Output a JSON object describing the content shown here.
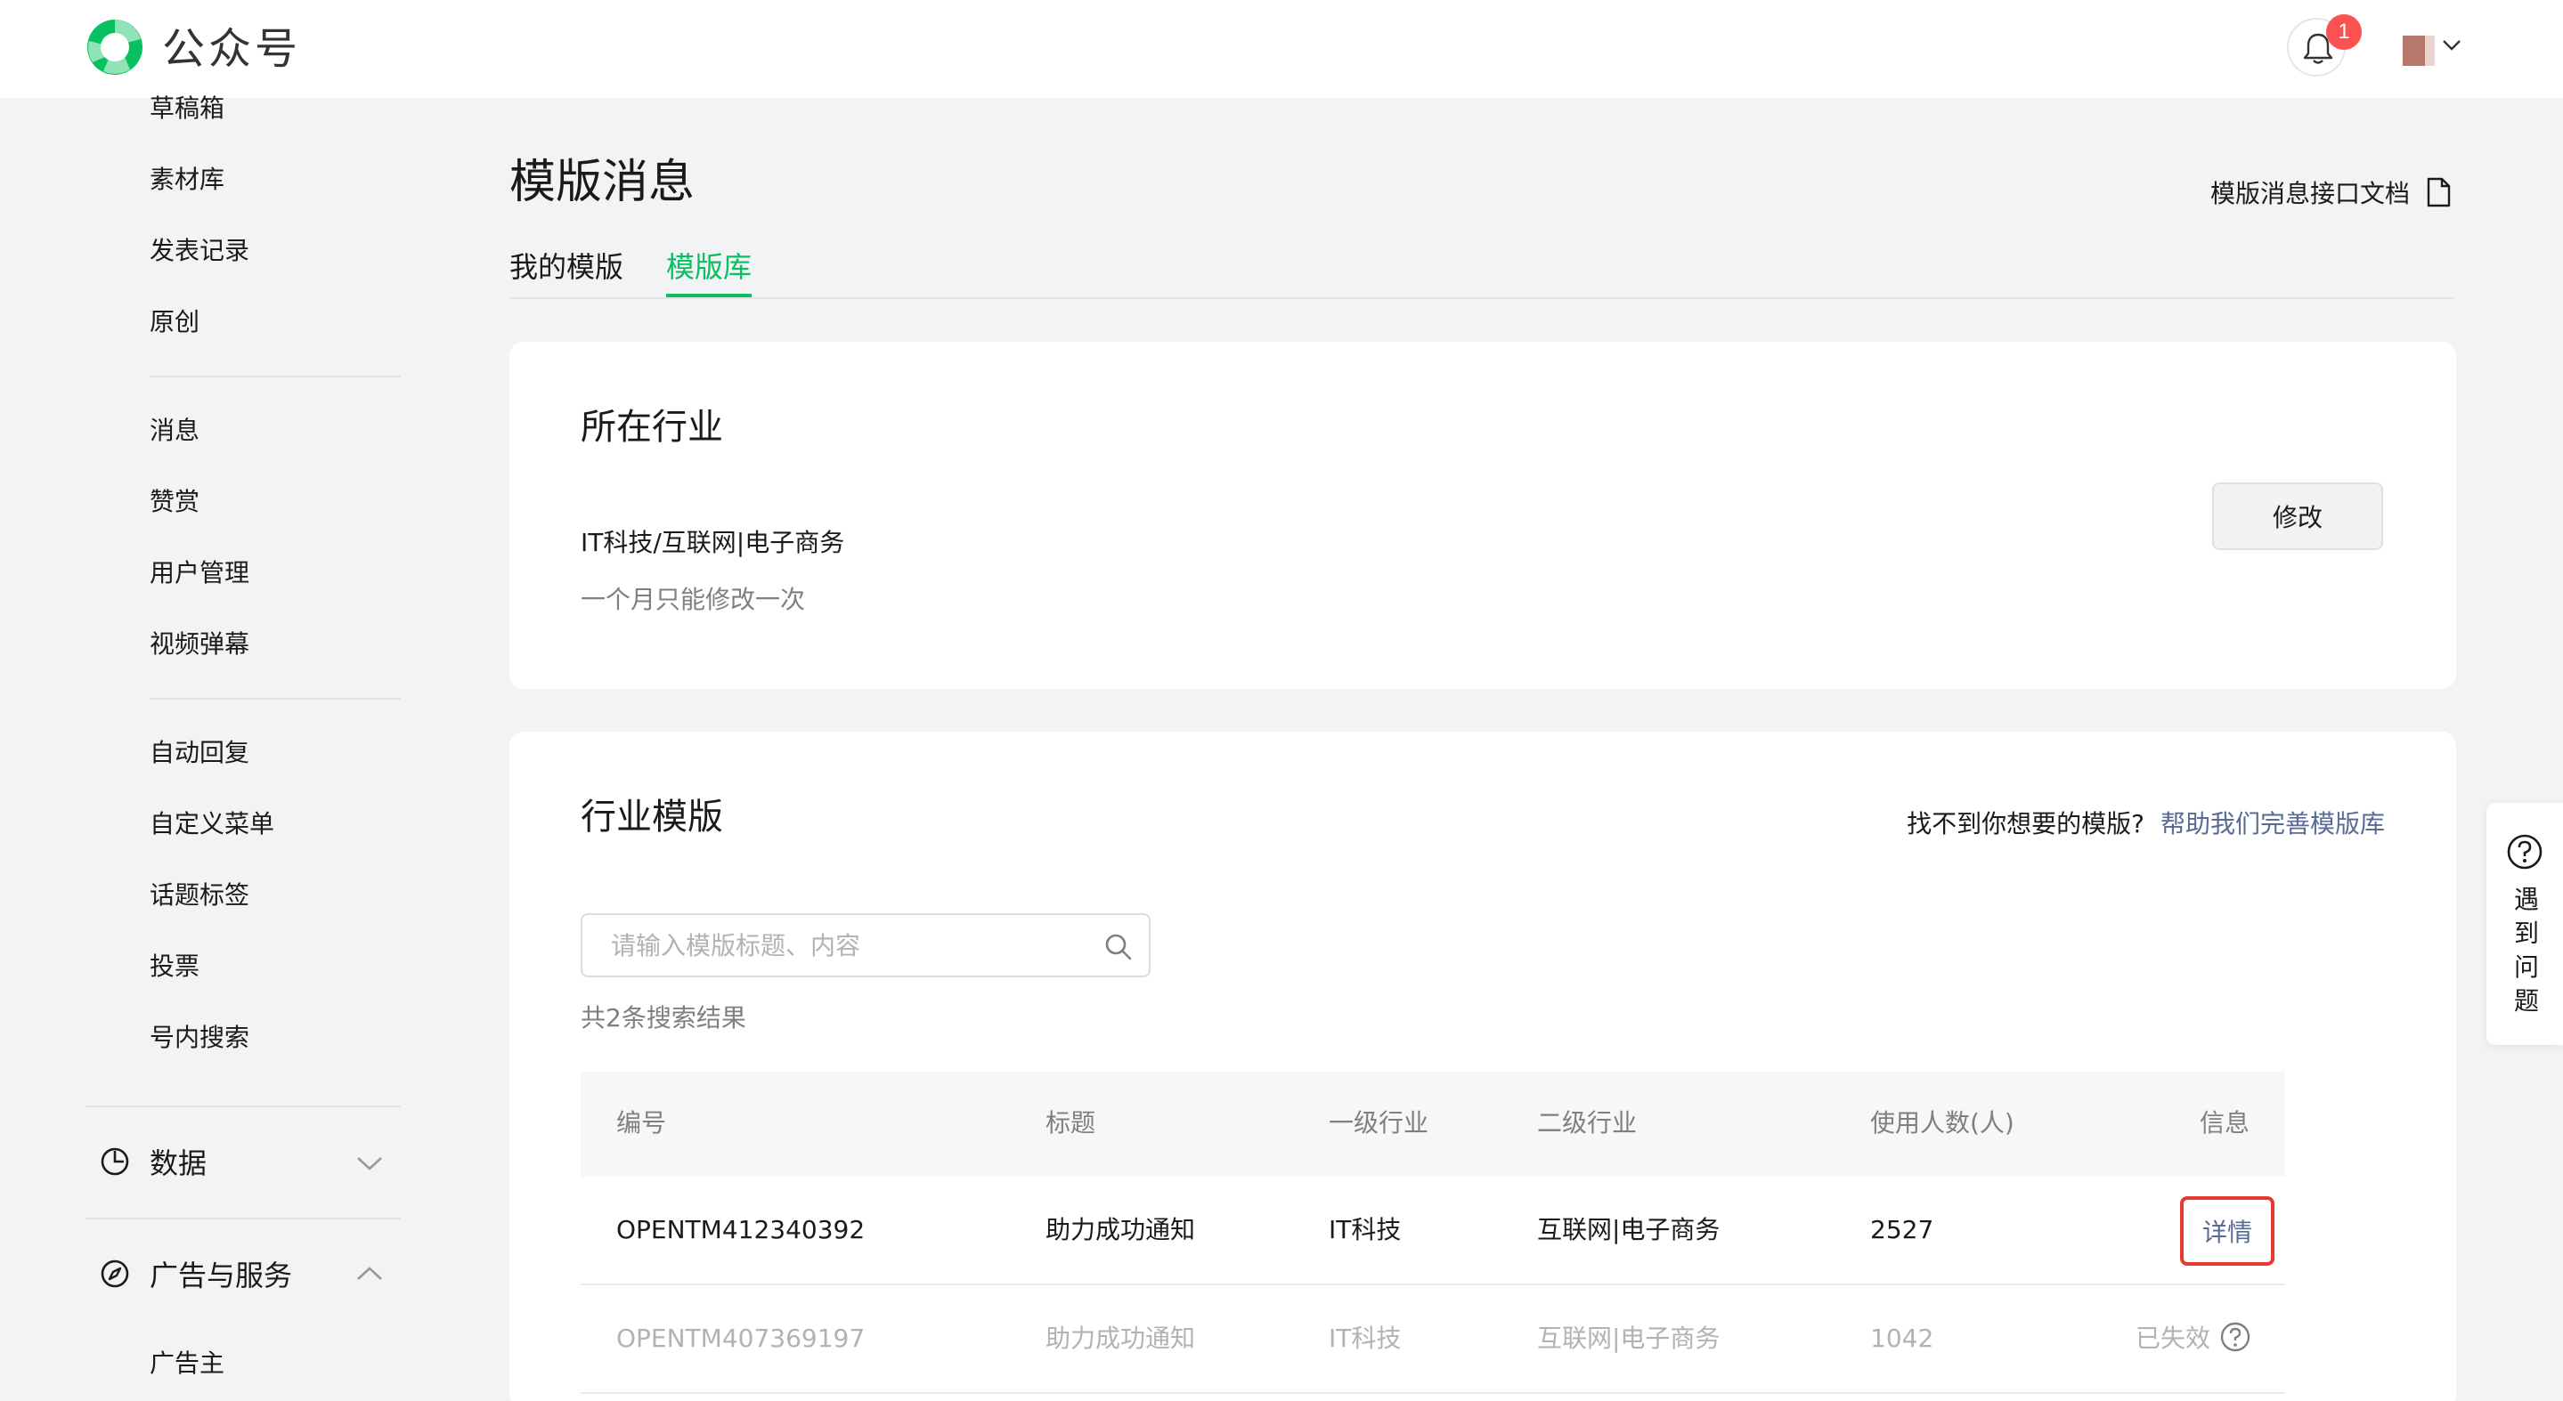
{
  "header": {
    "brand": "公众号",
    "notification_count": "1"
  },
  "sidebar": {
    "items_top": [
      "草稿箱",
      "素材库",
      "发表记录",
      "原创"
    ],
    "items_mid": [
      "消息",
      "赞赏",
      "用户管理",
      "视频弹幕"
    ],
    "items_low": [
      "自动回复",
      "自定义菜单",
      "话题标签",
      "投票",
      "号内搜索"
    ],
    "group_data": "数据",
    "group_ads": "广告与服务",
    "item_advertiser": "广告主"
  },
  "main": {
    "title": "模版消息",
    "doc_link": "模版消息接口文档",
    "tabs": [
      "我的模版",
      "模版库"
    ],
    "active_tab": "模版库"
  },
  "industry_card": {
    "title": "所在行业",
    "industry": "IT科技/互联网|电子商务",
    "tip": "一个月只能修改一次",
    "modify_button": "修改"
  },
  "template_card": {
    "title": "行业模版",
    "help_question": "找不到你想要的模版?",
    "help_link": "帮助我们完善模版库",
    "search_placeholder": "请输入模版标题、内容",
    "result_count": "共2条搜索结果",
    "columns": [
      "编号",
      "标题",
      "一级行业",
      "二级行业",
      "使用人数(人)",
      "信息"
    ],
    "rows": [
      {
        "id": "OPENTM412340392",
        "title": "助力成功通知",
        "level1": "IT科技",
        "level2": "互联网|电子商务",
        "users": "2527",
        "info": "详情",
        "status": "active"
      },
      {
        "id": "OPENTM407369197",
        "title": "助力成功通知",
        "level1": "IT科技",
        "level2": "互联网|电子商务",
        "users": "1042",
        "info": "已失效",
        "status": "expired"
      }
    ]
  },
  "float_help": {
    "label": "遇到问题"
  },
  "colors": {
    "accent_green": "#07c160",
    "link_blue": "#576b95",
    "badge_red": "#fa5151",
    "highlight_red": "#e8392f"
  }
}
